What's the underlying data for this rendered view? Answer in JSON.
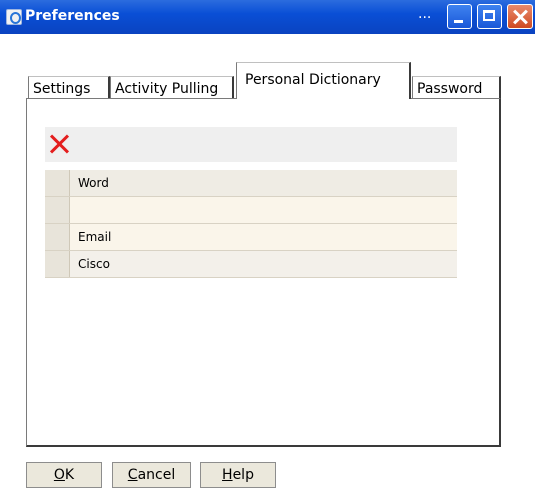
{
  "window": {
    "title": "Preferences",
    "title_ellipsis": "..."
  },
  "tabs": [
    {
      "label": "Settings",
      "active": false
    },
    {
      "label": "Activity Pulling",
      "active": false
    },
    {
      "label": "Personal Dictionary",
      "active": true
    },
    {
      "label": "Password",
      "active": false
    }
  ],
  "dictionary": {
    "header": "Word",
    "rows": [
      "",
      "Email",
      "Cisco"
    ]
  },
  "buttons": {
    "ok": {
      "mnemonic": "O",
      "rest": "K"
    },
    "cancel": {
      "mnemonic": "C",
      "rest": "ancel"
    },
    "help": {
      "mnemonic": "H",
      "rest": "elp"
    }
  },
  "colors": {
    "titlebar": "#0a4fd6",
    "delete_icon": "#e41e1e",
    "button_face": "#ebe8dc"
  }
}
